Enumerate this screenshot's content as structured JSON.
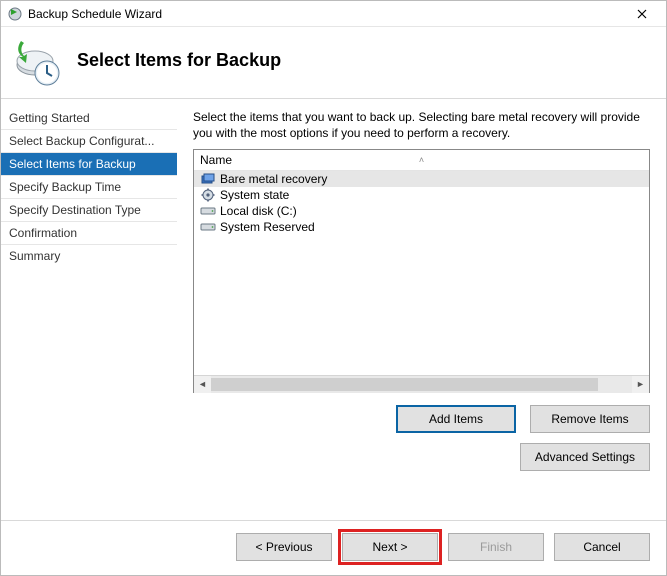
{
  "window": {
    "title": "Backup Schedule Wizard"
  },
  "header": {
    "title": "Select Items for Backup"
  },
  "sidebar": {
    "items": [
      {
        "label": "Getting Started",
        "active": false
      },
      {
        "label": "Select Backup Configurat...",
        "active": false
      },
      {
        "label": "Select Items for Backup",
        "active": true
      },
      {
        "label": "Specify Backup Time",
        "active": false
      },
      {
        "label": "Specify Destination Type",
        "active": false
      },
      {
        "label": "Confirmation",
        "active": false
      },
      {
        "label": "Summary",
        "active": false
      }
    ]
  },
  "main": {
    "instruction": "Select the items that you want to back up. Selecting bare metal recovery will provide you with the most options if you need to perform a recovery.",
    "column_header": "Name",
    "items": [
      {
        "label": "Bare metal recovery",
        "icon": "component-icon",
        "selected": true
      },
      {
        "label": "System state",
        "icon": "gear-icon",
        "selected": false
      },
      {
        "label": "Local disk (C:)",
        "icon": "drive-icon",
        "selected": false
      },
      {
        "label": "System Reserved",
        "icon": "drive-icon",
        "selected": false
      }
    ],
    "buttons": {
      "add": "Add Items",
      "remove": "Remove Items",
      "advanced": "Advanced Settings"
    }
  },
  "footer": {
    "previous": "< Previous",
    "next": "Next >",
    "finish": "Finish",
    "cancel": "Cancel"
  }
}
